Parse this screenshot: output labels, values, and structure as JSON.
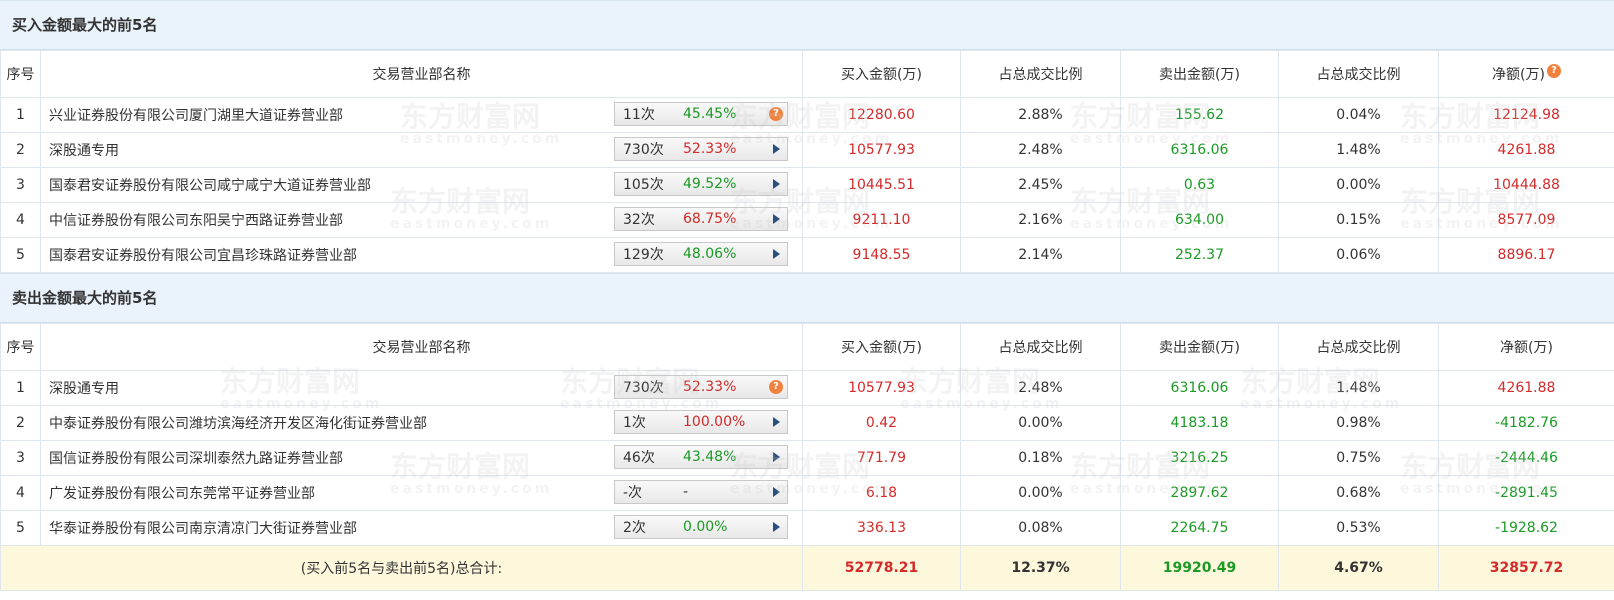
{
  "buy_section": {
    "title": "买入金额最大的前5名",
    "headers": [
      "序号",
      "交易营业部名称",
      "买入金额(万)",
      "占总成交比例",
      "卖出金额(万)",
      "占总成交比例",
      "净额(万)"
    ],
    "rows": [
      {
        "idx": "1",
        "name": "兴业证券股份有限公司厦门湖里大道证券营业部",
        "count": "11次",
        "pct": "45.45%",
        "pct_color": "green",
        "icon": "question-icon",
        "buy": "12280.60",
        "buy_ratio": "2.88%",
        "sell": "155.62",
        "sell_ratio": "0.04%",
        "net": "12124.98",
        "net_color": "red"
      },
      {
        "idx": "2",
        "name": "深股通专用",
        "count": "730次",
        "pct": "52.33%",
        "pct_color": "red",
        "icon": "arrow-right-icon",
        "buy": "10577.93",
        "buy_ratio": "2.48%",
        "sell": "6316.06",
        "sell_ratio": "1.48%",
        "net": "4261.88",
        "net_color": "red"
      },
      {
        "idx": "3",
        "name": "国泰君安证券股份有限公司咸宁咸宁大道证券营业部",
        "count": "105次",
        "pct": "49.52%",
        "pct_color": "green",
        "icon": "arrow-right-icon",
        "buy": "10445.51",
        "buy_ratio": "2.45%",
        "sell": "0.63",
        "sell_ratio": "0.00%",
        "net": "10444.88",
        "net_color": "red"
      },
      {
        "idx": "4",
        "name": "中信证券股份有限公司东阳吴宁西路证券营业部",
        "count": "32次",
        "pct": "68.75%",
        "pct_color": "red",
        "icon": "arrow-right-icon",
        "buy": "9211.10",
        "buy_ratio": "2.16%",
        "sell": "634.00",
        "sell_ratio": "0.15%",
        "net": "8577.09",
        "net_color": "red"
      },
      {
        "idx": "5",
        "name": "国泰君安证券股份有限公司宜昌珍珠路证券营业部",
        "count": "129次",
        "pct": "48.06%",
        "pct_color": "green",
        "icon": "arrow-right-icon",
        "buy": "9148.55",
        "buy_ratio": "2.14%",
        "sell": "252.37",
        "sell_ratio": "0.06%",
        "net": "8896.17",
        "net_color": "red"
      }
    ]
  },
  "sell_section": {
    "title": "卖出金额最大的前5名",
    "headers": [
      "序号",
      "交易营业部名称",
      "买入金额(万)",
      "占总成交比例",
      "卖出金额(万)",
      "占总成交比例",
      "净额(万)"
    ],
    "rows": [
      {
        "idx": "1",
        "name": "深股通专用",
        "count": "730次",
        "pct": "52.33%",
        "pct_color": "red",
        "icon": "question-icon",
        "buy": "10577.93",
        "buy_ratio": "2.48%",
        "sell": "6316.06",
        "sell_ratio": "1.48%",
        "net": "4261.88",
        "net_color": "red"
      },
      {
        "idx": "2",
        "name": "中泰证券股份有限公司潍坊滨海经济开发区海化街证券营业部",
        "count": "1次",
        "pct": "100.00%",
        "pct_color": "red",
        "icon": "arrow-right-icon",
        "buy": "0.42",
        "buy_ratio": "0.00%",
        "sell": "4183.18",
        "sell_ratio": "0.98%",
        "net": "-4182.76",
        "net_color": "green"
      },
      {
        "idx": "3",
        "name": "国信证券股份有限公司深圳泰然九路证券营业部",
        "count": "46次",
        "pct": "43.48%",
        "pct_color": "green",
        "icon": "arrow-right-icon",
        "buy": "771.79",
        "buy_ratio": "0.18%",
        "sell": "3216.25",
        "sell_ratio": "0.75%",
        "net": "-2444.46",
        "net_color": "green"
      },
      {
        "idx": "4",
        "name": "广发证券股份有限公司东莞常平证券营业部",
        "count": "-次",
        "pct": "-",
        "pct_color": "dark",
        "icon": "arrow-right-icon",
        "buy": "6.18",
        "buy_ratio": "0.00%",
        "sell": "2897.62",
        "sell_ratio": "0.68%",
        "net": "-2891.45",
        "net_color": "green"
      },
      {
        "idx": "5",
        "name": "华泰证券股份有限公司南京清凉门大街证券营业部",
        "count": "2次",
        "pct": "0.00%",
        "pct_color": "green",
        "icon": "arrow-right-icon",
        "buy": "336.13",
        "buy_ratio": "0.08%",
        "sell": "2264.75",
        "sell_ratio": "0.53%",
        "net": "-1928.62",
        "net_color": "green"
      }
    ]
  },
  "total": {
    "label": "(买入前5名与卖出前5名)总合计:",
    "buy": "52778.21",
    "buy_ratio": "12.37%",
    "sell": "19920.49",
    "sell_ratio": "4.67%",
    "net": "32857.72"
  },
  "watermark": {
    "cn": "东方财富网",
    "en": "eastmoney.com"
  },
  "colors": {
    "red": "#d42a2a",
    "green": "#1b9a25",
    "header_bg": "#eaf3fb",
    "total_bg": "#fdf7dc",
    "icon_orange": "#f0803c"
  }
}
